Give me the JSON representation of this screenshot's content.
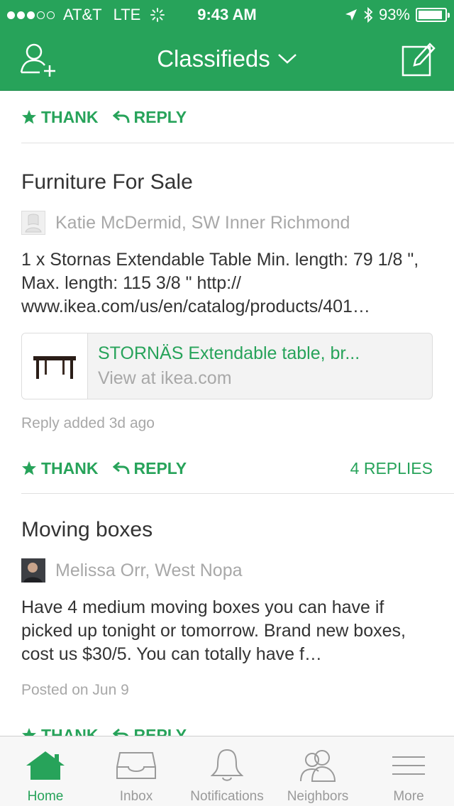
{
  "status": {
    "carrier": "AT&T",
    "network": "LTE",
    "time": "9:43 AM",
    "battery": "93%",
    "battery_level": 0.93
  },
  "nav": {
    "title": "Classifieds"
  },
  "colors": {
    "brand": "#27a35a",
    "muted": "#a8a8a8"
  },
  "feed": {
    "top_actions": {
      "thank": "THANK",
      "reply": "REPLY"
    },
    "posts": [
      {
        "title": "Furniture For Sale",
        "author": "Katie McDermid, SW Inner Richmond",
        "body": "1 x Stornas Extendable Table Min. length: 79 1/8 \", Max. length: 115 3/8 \" http:// www.ikea.com/us/en/catalog/products/401…",
        "link": {
          "title": "STORNÄS Extendable table, br...",
          "subtitle": "View at ikea.com"
        },
        "meta": "Reply added 3d ago",
        "actions": {
          "thank": "THANK",
          "reply": "REPLY",
          "replies": "4 REPLIES"
        }
      },
      {
        "title": "Moving boxes",
        "author": "Melissa Orr, West Nopa",
        "body": "Have 4 medium moving boxes you can have if picked up tonight or tomorrow. Brand new boxes, cost us $30/5. You can totally have f…",
        "meta": "Posted on Jun 9",
        "actions": {
          "thank": "THANK",
          "reply": "REPLY"
        }
      }
    ]
  },
  "tabs": [
    {
      "label": "Home",
      "icon": "home-icon",
      "active": true
    },
    {
      "label": "Inbox",
      "icon": "inbox-icon"
    },
    {
      "label": "Notifications",
      "icon": "bell-icon"
    },
    {
      "label": "Neighbors",
      "icon": "neighbors-icon"
    },
    {
      "label": "More",
      "icon": "menu-icon"
    }
  ]
}
